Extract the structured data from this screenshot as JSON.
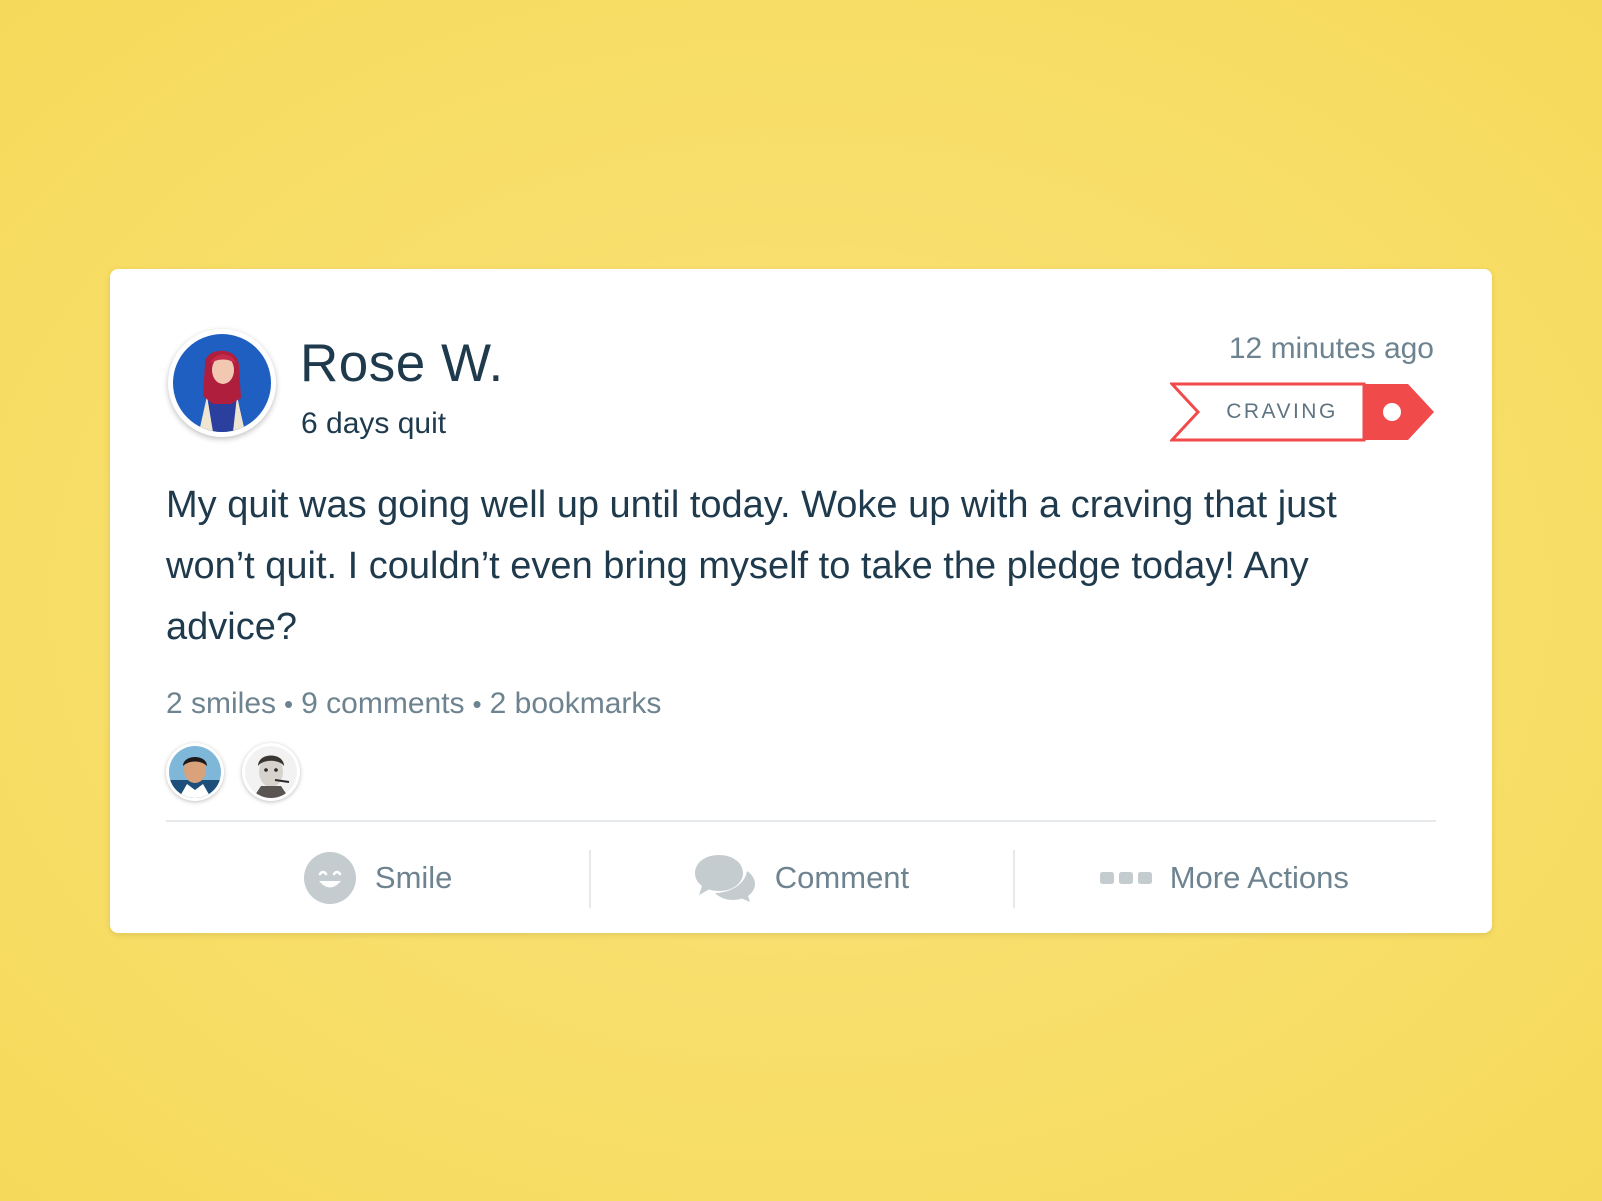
{
  "post": {
    "author": {
      "name": "Rose W.",
      "status": "6 days quit"
    },
    "timestamp": "12 minutes ago",
    "tag": {
      "label": "CRAVING",
      "color": "#f04a4a"
    },
    "body": "My quit was going well up until today. Woke up with a craving that just won’t quit. I couldn’t even bring myself to take the pledge today! Any advice?",
    "stats": {
      "smiles": "2 smiles",
      "comments": "9 comments",
      "bookmarks": "2 bookmarks",
      "separator": "•"
    },
    "reactors": [
      {
        "icon": "user-avatar-1"
      },
      {
        "icon": "user-avatar-2"
      }
    ]
  },
  "actions": {
    "smile": {
      "label": "Smile",
      "icon": "smile-icon"
    },
    "comment": {
      "label": "Comment",
      "icon": "chat-bubbles-icon"
    },
    "more": {
      "label": "More Actions",
      "icon": "more-dots-icon"
    }
  },
  "colors": {
    "background": "#f7dd65",
    "text_primary": "#1e3a4c",
    "text_secondary": "#6e8390",
    "icon_gray": "#c5ccd0",
    "accent_red": "#f04a4a"
  }
}
